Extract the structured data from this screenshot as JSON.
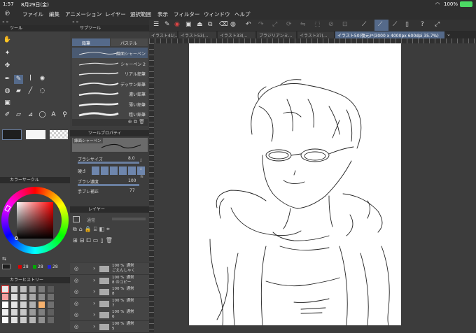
{
  "status": {
    "time": "1:57",
    "date": "8月29日(金)",
    "battery": "100%"
  },
  "menu": {
    "items": [
      "ファイル",
      "編集",
      "アニメーション",
      "レイヤー",
      "選択範囲",
      "表示",
      "フィルター",
      "ウィンドウ",
      "ヘルプ"
    ]
  },
  "tabs": [
    {
      "label": "イラスト41(...",
      "active": false
    },
    {
      "label": "イラスト53(...",
      "active": false
    },
    {
      "label": "イラスト33(...",
      "active": false
    },
    {
      "label": "ブラジリアンミ...",
      "active": false
    },
    {
      "label": "イラスト37(...",
      "active": false
    },
    {
      "label": "イラスト50(復元)*(3000 x 4000px 600dpi 35.7%)",
      "active": true
    }
  ],
  "tool_panel": {
    "title": "ツール"
  },
  "subtool_panel": {
    "title": "サブツール",
    "tabs": [
      "鉛筆",
      "パステル"
    ],
    "brushes": [
      "練面シャーペン",
      "シャーペン 2",
      "リアル鉛筆",
      "デッサン鉛筆",
      "濃い鉛筆",
      "薄い鉛筆",
      "粗い鉛筆"
    ]
  },
  "tool_property": {
    "title": "ツールプロパティ",
    "brush_name": "練面シャーペン",
    "brush_size_label": "ブラシサイズ",
    "brush_size_value": "8.0",
    "hardness_label": "硬さ",
    "density_label": "ブラシ濃度",
    "density_value": "100",
    "stabilization_label": "手ブレ補正",
    "stabilization_value": "77"
  },
  "layer_panel": {
    "title": "レイヤー",
    "blend_label": "通常",
    "layers": [
      {
        "opacity": "100 %",
        "mode": "通常",
        "name": "ごえんしゃく"
      },
      {
        "opacity": "100 %",
        "mode": "通常",
        "name": "8 のコピー"
      },
      {
        "opacity": "100 %",
        "mode": "通常",
        "name": "8"
      },
      {
        "opacity": "100 %",
        "mode": "通常",
        "name": "7"
      },
      {
        "opacity": "100 %",
        "mode": "通常",
        "name": "6"
      },
      {
        "opacity": "100 %",
        "mode": "通常",
        "name": "5"
      }
    ]
  },
  "color_circle": {
    "title": "カラーサークル",
    "r": "28",
    "g": "28",
    "b": "28"
  },
  "color_history": {
    "title": "カラーヒストリー"
  }
}
